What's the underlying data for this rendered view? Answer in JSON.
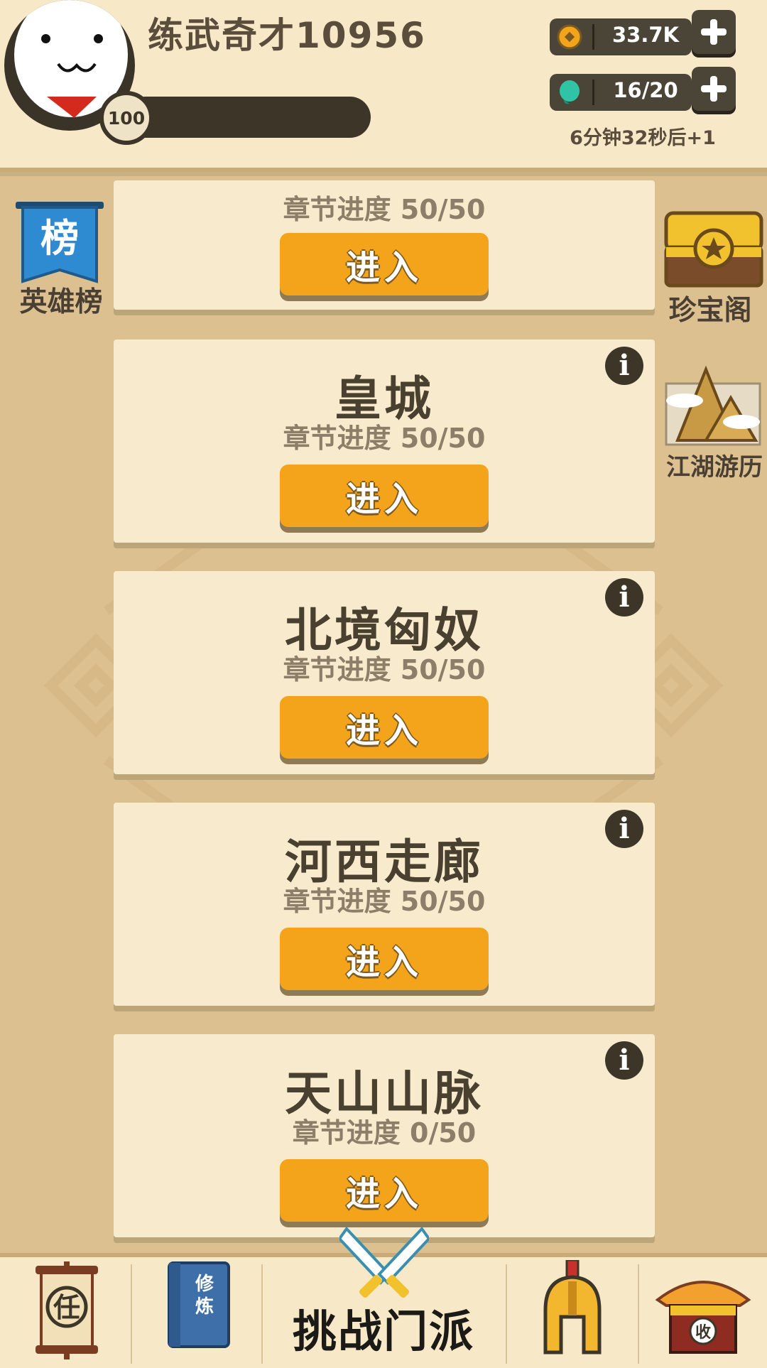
{
  "player": {
    "name": "练武奇才10956",
    "level": "100"
  },
  "resources": {
    "coins": "33.7K",
    "energy": "16/20",
    "energy_timer": "6分钟32秒后+1"
  },
  "side_buttons": {
    "left": {
      "label": "英雄榜",
      "badge_char": "榜"
    },
    "right_top": {
      "label": "珍宝阁"
    },
    "right_mid": {
      "label": "江湖游历"
    }
  },
  "chapters": [
    {
      "title": "",
      "progress": "章节进度 50/50",
      "enter_label": "进入"
    },
    {
      "title": "皇城",
      "progress": "章节进度 50/50",
      "enter_label": "进入"
    },
    {
      "title": "北境匈奴",
      "progress": "章节进度 50/50",
      "enter_label": "进入"
    },
    {
      "title": "河西走廊",
      "progress": "章节进度 50/50",
      "enter_label": "进入"
    },
    {
      "title": "天山山脉",
      "progress": "章节进度 0/50",
      "enter_label": "进入"
    }
  ],
  "bottom_nav": {
    "task_char": "任",
    "book_chars": "修炼",
    "challenge_label": "挑战门派",
    "shop_char": "收"
  },
  "colors": {
    "accent_orange": "#f4a41a",
    "card_bg": "#f8ebcd",
    "page_bg": "#dcc08f",
    "dark": "#3d3628"
  }
}
